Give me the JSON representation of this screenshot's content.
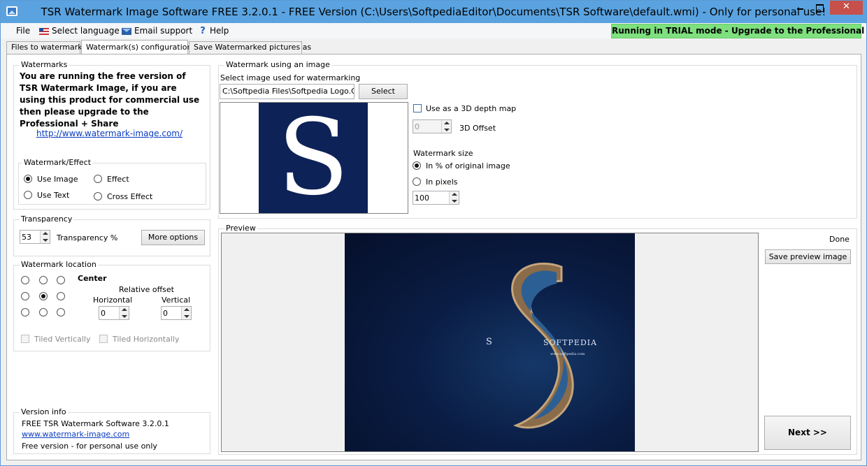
{
  "window": {
    "title": "TSR Watermark Image Software FREE 3.2.0.1 - FREE Version (C:\\Users\\SoftpediaEditor\\Documents\\TSR Software\\default.wmi) - Only for personal use!",
    "minimize": "",
    "maximize": "",
    "close": "✕"
  },
  "menu": {
    "file": "File",
    "language": "Select language",
    "email": "Email support",
    "help": "Help",
    "help_icon": "?"
  },
  "trial_banner": "Running in TRIAL mode - Upgrade to the Professional version",
  "tabs": [
    "Files to watermark",
    "Watermark(s) configuration",
    "Save Watermarked pictures as"
  ],
  "watermarks": {
    "legend": "Watermarks",
    "message": "You are running the free version of TSR Watermark Image, if you are using this product for commercial use then please upgrade to the Professional + Share",
    "link": "http://www.watermark-image.com/"
  },
  "effect": {
    "legend": "Watermark/Effect",
    "use_image": "Use Image",
    "effect": "Effect",
    "use_text": "Use Text",
    "cross_effect": "Cross Effect"
  },
  "transparency": {
    "legend": "Transparency",
    "value": "53",
    "label": "Transparency %",
    "more_options": "More options"
  },
  "location": {
    "legend": "Watermark location",
    "center": "Center",
    "relative_offset": "Relative offset",
    "horizontal": "Horizontal",
    "vertical": "Vertical",
    "h_value": "0",
    "v_value": "0",
    "tiled_v": "Tiled Vertically",
    "tiled_h": "Tiled Horizontally"
  },
  "version": {
    "legend": "Version info",
    "line1": "FREE TSR Watermark Software 3.2.0.1",
    "link": "www.watermark-image.com",
    "line3": "Free version - for personal use only"
  },
  "image_group": {
    "legend": "Watermark using an image",
    "select_label": "Select image used for watermarking",
    "path": "C:\\Softpedia Files\\Softpedia Logo.Gi",
    "select_button": "Select",
    "logo_letter": "S",
    "depth_map": "Use as a 3D depth map",
    "offset_value": "0",
    "offset_label": "3D Offset",
    "size_label": "Watermark size",
    "percent_option": "In % of original image",
    "pixels_option": "In pixels",
    "size_value": "100"
  },
  "preview": {
    "legend": "Preview",
    "status": "Done",
    "save_button": "Save preview image",
    "next_button": "Next >>",
    "image_letter": "S",
    "image_brand": "SOFTPEDIA",
    "image_url": "www.softpedia.com"
  }
}
